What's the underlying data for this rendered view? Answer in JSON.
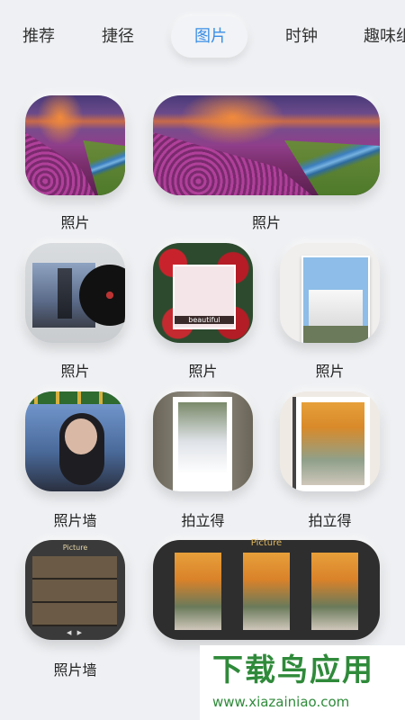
{
  "tabs": [
    {
      "label": "推荐",
      "active": false
    },
    {
      "label": "捷径",
      "active": false
    },
    {
      "label": "图片",
      "active": true
    },
    {
      "label": "时钟",
      "active": false
    },
    {
      "label": "趣味组",
      "active": false
    }
  ],
  "widgets": [
    {
      "name": "photo-widget-small",
      "label": "照片"
    },
    {
      "name": "photo-widget-wide",
      "label": "照片"
    },
    {
      "name": "photo-widget-vinyl",
      "label": "照片"
    },
    {
      "name": "photo-widget-roses",
      "label": "照片"
    },
    {
      "name": "photo-widget-castle",
      "label": "照片"
    },
    {
      "name": "photo-wall-widget",
      "label": "照片墙"
    },
    {
      "name": "polaroid-widget-1",
      "label": "拍立得"
    },
    {
      "name": "polaroid-widget-2",
      "label": "拍立得"
    },
    {
      "name": "photo-wall-widget-bears",
      "label": "照片墙"
    },
    {
      "name": "tulip-strip-widget",
      "label": ""
    }
  ],
  "widget_text": {
    "roses_caption": "beautiful",
    "bears_header": "Picture",
    "bears_controls": "◀ ▶",
    "strip_header": "Picture"
  },
  "watermark": {
    "title": "下载鸟应用",
    "url": "www.xiazainiao.com"
  },
  "colors": {
    "active_tab": "#3a8ee6",
    "background": "#eef0f3",
    "watermark_green": "#2f8a3a"
  }
}
